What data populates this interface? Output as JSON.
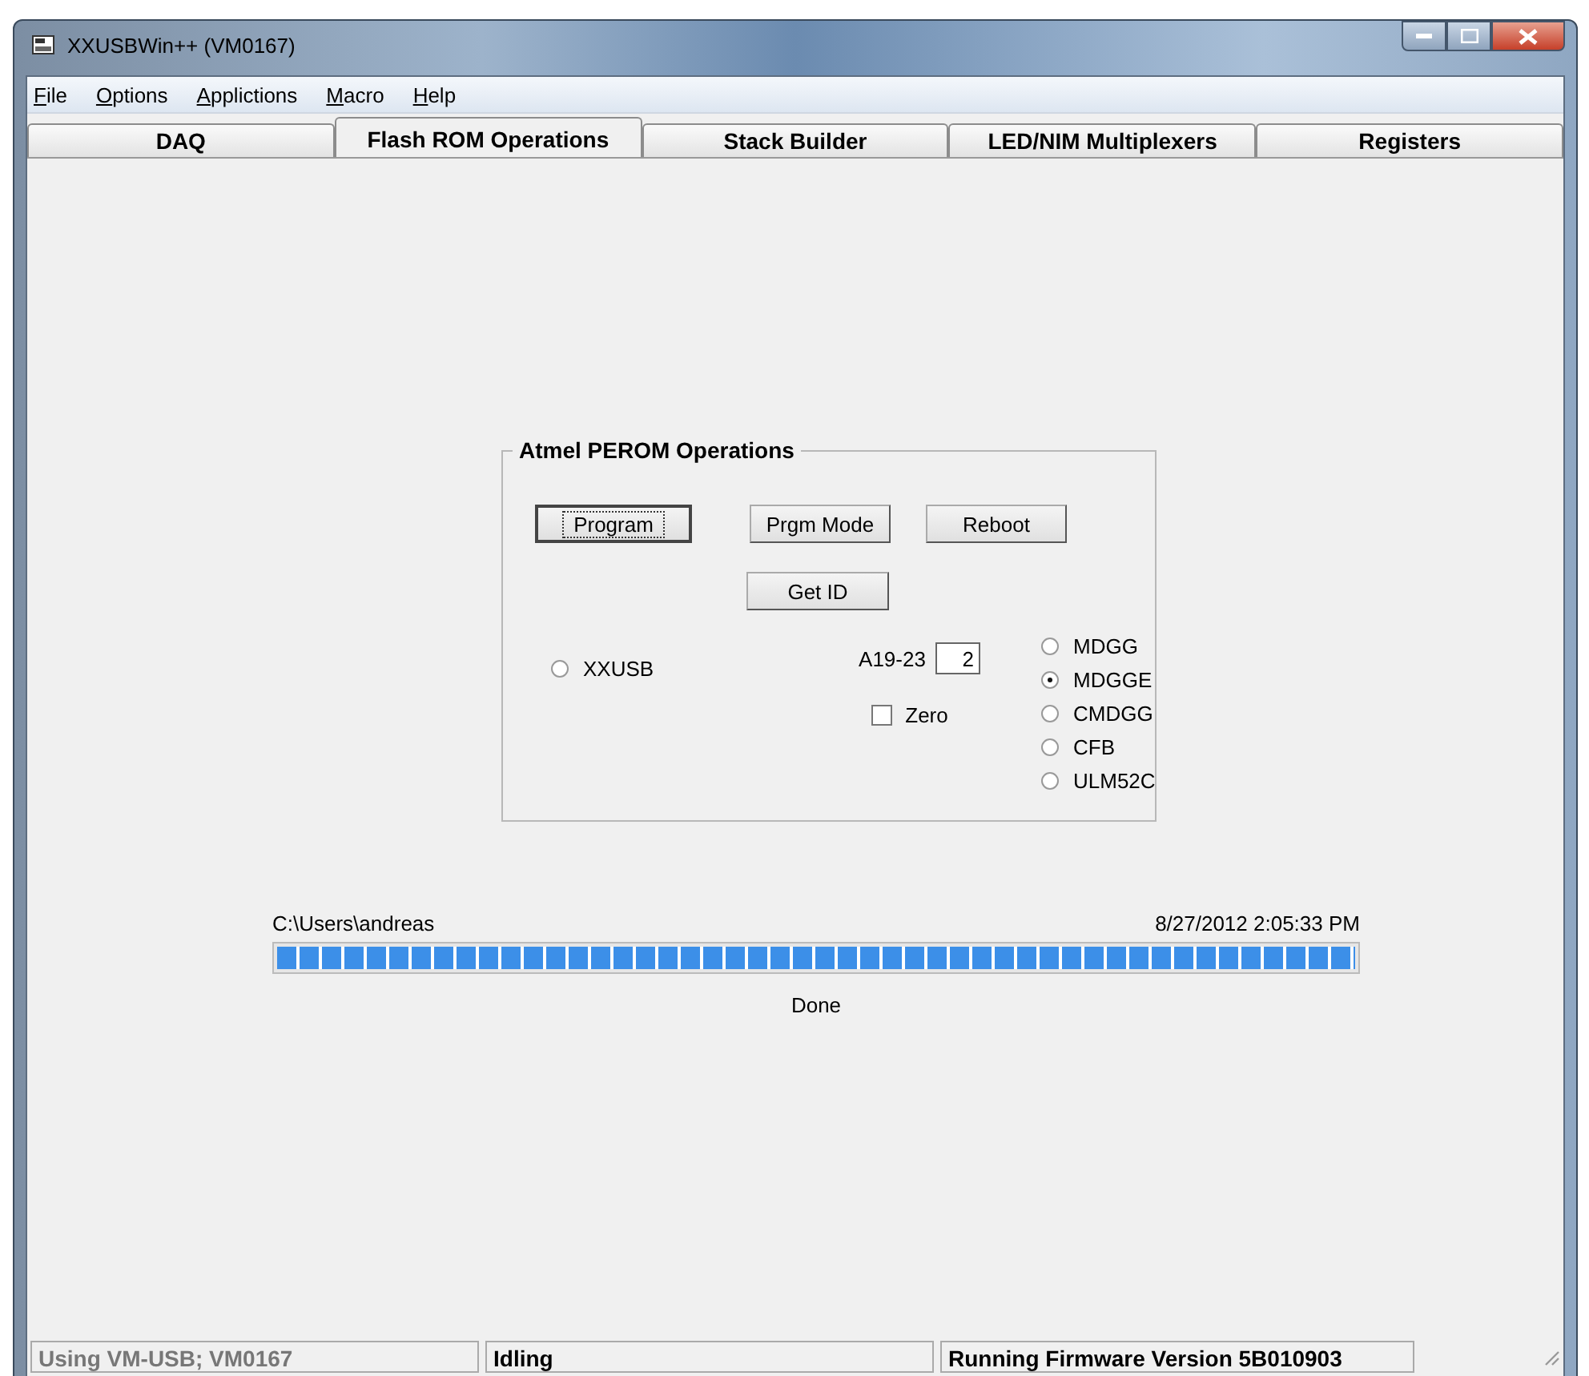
{
  "window": {
    "title": "XXUSBWin++ (VM0167)"
  },
  "menu": [
    {
      "access_key": "F",
      "rest": "ile"
    },
    {
      "access_key": "O",
      "rest": "ptions"
    },
    {
      "access_key": "A",
      "rest": "pplictions"
    },
    {
      "access_key": "M",
      "rest": "acro"
    },
    {
      "access_key": "H",
      "rest": "elp"
    }
  ],
  "tabs": [
    {
      "label": "DAQ",
      "selected": false
    },
    {
      "label": "Flash ROM Operations",
      "selected": true
    },
    {
      "label": "Stack Builder",
      "selected": false
    },
    {
      "label": "LED/NIM Multiplexers",
      "selected": false
    },
    {
      "label": "Registers",
      "selected": false
    }
  ],
  "group": {
    "title": "Atmel PEROM Operations",
    "buttons": [
      {
        "label": "Program",
        "focused": true
      },
      {
        "label": "Prgm Mode",
        "focused": false
      },
      {
        "label": "Reboot",
        "focused": false
      }
    ],
    "get_id_button": {
      "label": "Get ID"
    },
    "xxusb_radio": {
      "label": "XXUSB",
      "selected": false
    },
    "address": {
      "label": "A19-23",
      "value": "2"
    },
    "zero_checkbox": {
      "label": "Zero",
      "checked": false
    },
    "modules": [
      {
        "label": "MDGG",
        "selected": false
      },
      {
        "label": "MDGGE",
        "selected": true
      },
      {
        "label": "CMDGG",
        "selected": false
      },
      {
        "label": "CFB",
        "selected": false
      },
      {
        "label": "ULM52C",
        "selected": false
      }
    ]
  },
  "progress": {
    "path": "C:\\Users\\andreas",
    "timestamp": "8/27/2012 2:05:33 PM",
    "level": 1,
    "status": "Done"
  },
  "status_bar": [
    {
      "text": "Using VM-USB; VM0167",
      "disabled": true
    },
    {
      "text": "Idling",
      "disabled": false
    },
    {
      "text": "Running Firmware Version 5B010903",
      "disabled": false
    }
  ]
}
